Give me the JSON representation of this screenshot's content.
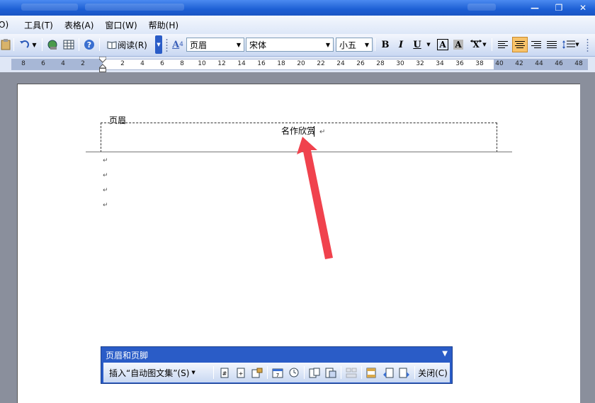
{
  "window": {
    "buttons": [
      "—",
      "❐",
      "✕"
    ]
  },
  "menubar": {
    "items": [
      "O)",
      "工具(T)",
      "表格(A)",
      "窗口(W)",
      "帮助(H)"
    ]
  },
  "toolbar": {
    "read_label": "阅读(R)",
    "style_value": "页眉",
    "font_value": "宋体",
    "size_value": "小五",
    "bold": "B",
    "italic": "I",
    "underline": "U",
    "char_border": "A",
    "char_shading": "A",
    "style_icon": "A",
    "align_center_active": true
  },
  "ruler": {
    "ticks": [
      "8",
      "6",
      "4",
      "2",
      "2",
      "4",
      "6",
      "8",
      "10",
      "12",
      "14",
      "16",
      "18",
      "20",
      "22",
      "24",
      "26",
      "28",
      "30",
      "32",
      "34",
      "36",
      "38",
      "40",
      "42",
      "44",
      "46",
      "48"
    ]
  },
  "document": {
    "header_tag": "页眉",
    "header_text": "名作欣赏",
    "paragraph_marks": [
      "↵",
      "↵",
      "↵",
      "↵"
    ]
  },
  "hf_toolbar": {
    "title": "页眉和页脚",
    "insert_autotext": "插入“自动图文集”(S)",
    "close_label": "关闭(C)"
  },
  "colors": {
    "annotation_arrow": "#f0424d",
    "titlebar": "#1d5fd4",
    "active_button": "#f8c36a"
  }
}
